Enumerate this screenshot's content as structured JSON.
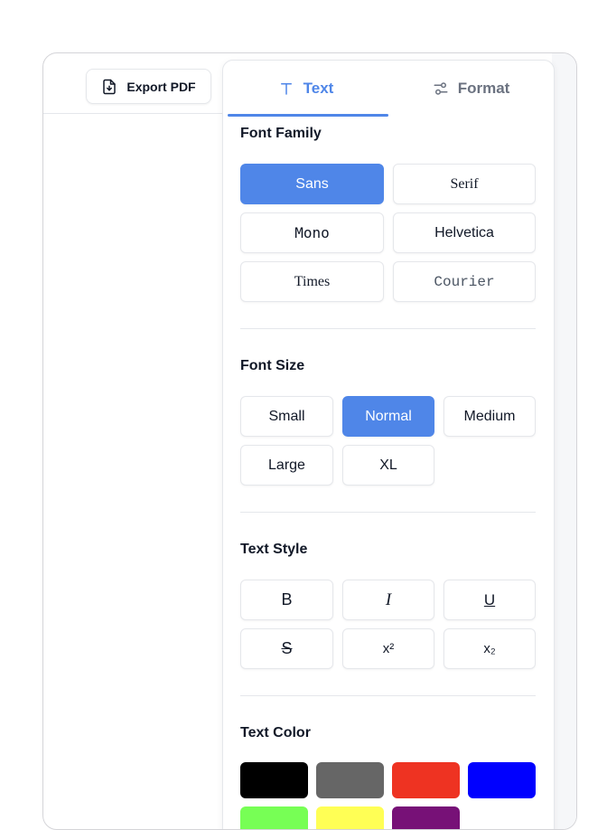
{
  "toolbar": {
    "export_label": "Export PDF"
  },
  "tabs": [
    {
      "label": "Text",
      "icon": "text-type-icon",
      "active": true
    },
    {
      "label": "Format",
      "icon": "sliders-icon",
      "active": false
    }
  ],
  "font_family": {
    "title": "Font Family",
    "options": [
      "Sans",
      "Serif",
      "Mono",
      "Helvetica",
      "Times",
      "Courier"
    ],
    "selected": "Sans"
  },
  "font_size": {
    "title": "Font Size",
    "options": [
      "Small",
      "Normal",
      "Medium",
      "Large",
      "XL"
    ],
    "selected": "Normal"
  },
  "text_style": {
    "title": "Text Style",
    "options": [
      {
        "glyph": "B",
        "icon": "bold-icon"
      },
      {
        "glyph": "I",
        "icon": "italic-icon"
      },
      {
        "glyph": "U",
        "icon": "underline-icon"
      },
      {
        "glyph": "S",
        "icon": "strikethrough-icon"
      },
      {
        "glyph": "x²",
        "icon": "superscript-icon"
      },
      {
        "glyph": "x₂",
        "icon": "subscript-icon"
      }
    ]
  },
  "text_color": {
    "title": "Text Color",
    "swatches": [
      "#000000",
      "#666666",
      "#ee3322",
      "#0000ff",
      "#77ff55",
      "#ffff55",
      "#771177"
    ]
  }
}
